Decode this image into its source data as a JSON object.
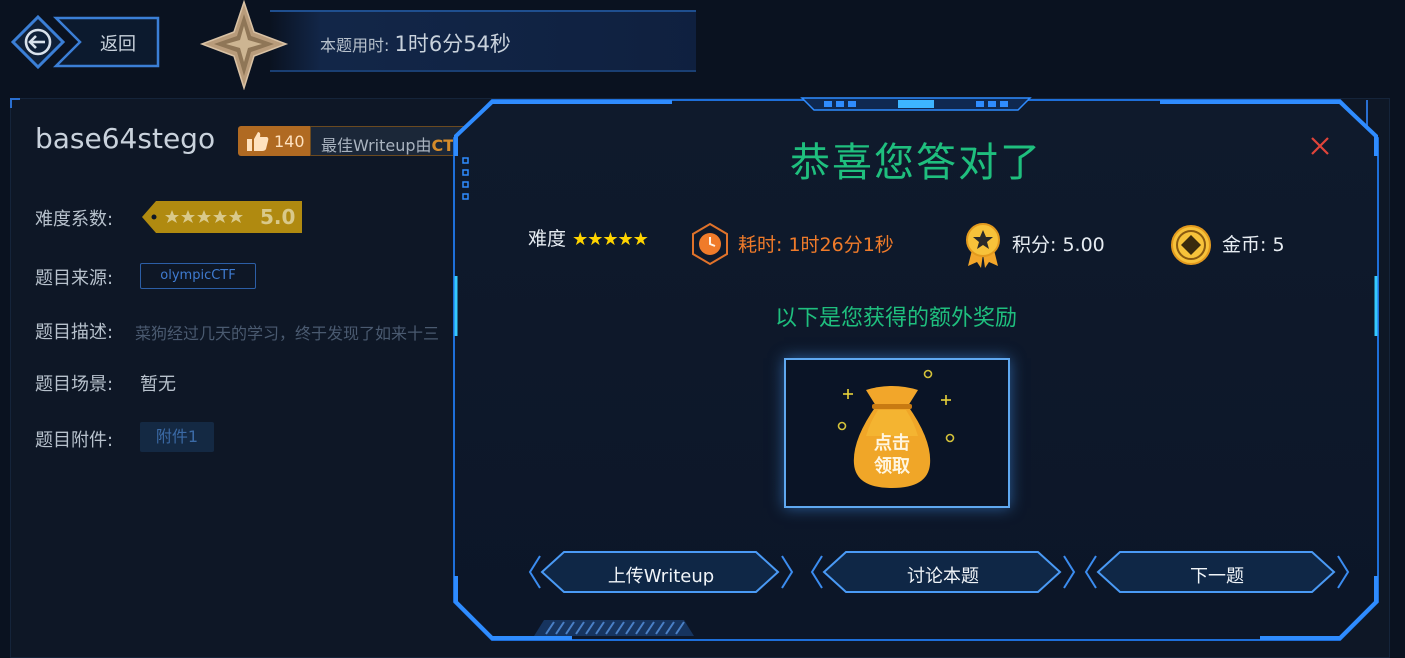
{
  "header": {
    "back_label": "返回",
    "timer_label": "本题用时: ",
    "timer_value": "1时6分54秒"
  },
  "challenge": {
    "title": "base64stego",
    "likes": "140",
    "best_writeup_prefix": "最佳Writeup由",
    "best_writeup_author": "CT",
    "difficulty_label": "难度系数:",
    "difficulty_value": "5.0",
    "difficulty_stars": 5,
    "source_label": "题目来源:",
    "source_value": "olympicCTF",
    "description_label": "题目描述:",
    "description_value": "菜狗经过几天的学习，终于发现了如来十三",
    "scene_label": "题目场景:",
    "scene_value": "暂无",
    "attachment_label": "题目附件:",
    "attachment_value": "附件1"
  },
  "modal": {
    "title": "恭喜您答对了",
    "difficulty_label": "难度",
    "difficulty_stars": "★★★★★",
    "time_label": "耗时: 1时26分1秒",
    "score_label": "积分: 5.00",
    "coin_label": "金币: 5",
    "bonus_title": "以下是您获得的额外奖励",
    "reward_text_line1": "点击",
    "reward_text_line2": "领取",
    "buttons": {
      "upload": "上传Writeup",
      "discuss": "讨论本题",
      "next": "下一题"
    }
  },
  "colors": {
    "accent_green": "#1fbf7e",
    "accent_orange": "#f07b2a",
    "frame_blue": "#1e6fd9",
    "close_red": "#e0443a",
    "gold": "#f2a62a"
  }
}
